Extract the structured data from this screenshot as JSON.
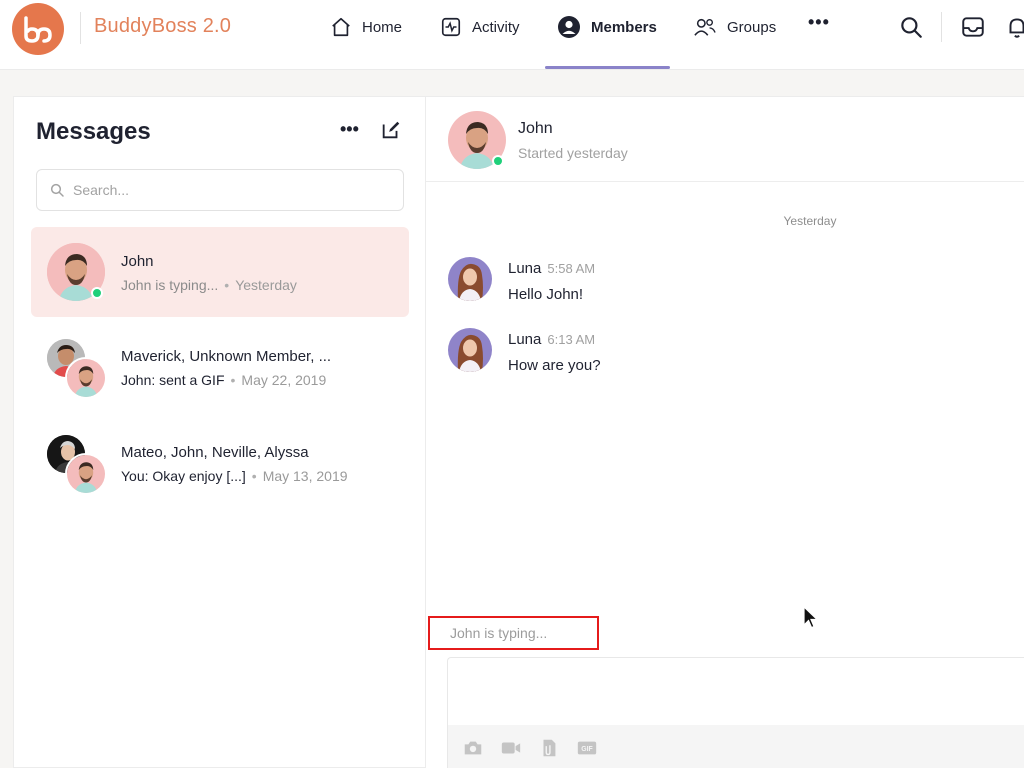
{
  "brand": {
    "name": "BuddyBoss 2.0",
    "logo_icon": "buddyboss-logo-icon",
    "accent": "#e5774c"
  },
  "nav": [
    {
      "label": "Home",
      "icon": "home-icon"
    },
    {
      "label": "Activity",
      "icon": "activity-icon"
    },
    {
      "label": "Members",
      "icon": "member-icon",
      "active": true
    },
    {
      "label": "Groups",
      "icon": "groups-icon"
    }
  ],
  "header_icons": [
    "search-icon",
    "inbox-icon",
    "bell-icon"
  ],
  "messages": {
    "title": "Messages",
    "search_placeholder": "Search...",
    "threads": [
      {
        "name": "John",
        "excerpt": "John is typing...",
        "date": "Yesterday",
        "active": true,
        "online": true
      },
      {
        "name": "Maverick, Unknown Member, ...",
        "excerpt": "John: sent a GIF",
        "date": "May 22, 2019",
        "active": false
      },
      {
        "name": "Mateo, John, Neville, Alyssa",
        "excerpt": "You: Okay enjoy [...]",
        "date": "May 13, 2019",
        "active": false
      }
    ]
  },
  "chat": {
    "name": "John",
    "subtitle": "Started yesterday",
    "day_separator": "Yesterday",
    "messages": [
      {
        "author": "Luna",
        "time": "5:58 AM",
        "text": "Hello John!"
      },
      {
        "author": "Luna",
        "time": "6:13 AM",
        "text": "How are you?"
      }
    ],
    "typing_indicator": "John is typing...",
    "composer_tools": [
      "camera-icon",
      "video-icon",
      "document-icon",
      "gif-icon"
    ]
  }
}
